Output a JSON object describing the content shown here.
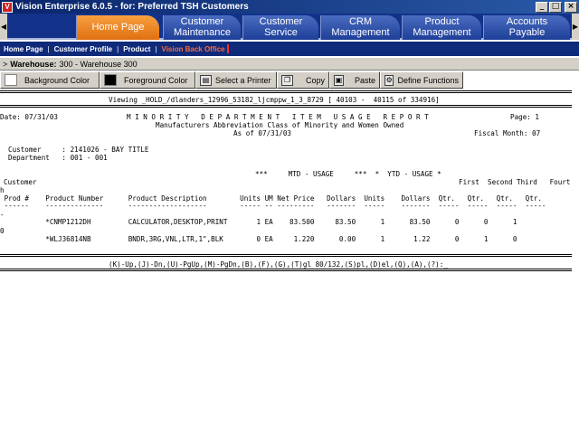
{
  "window": {
    "app_icon_glyph": "V",
    "title": "Vision Enterprise 6.0.5 - for:  Preferred TSH Customers",
    "minimize_glyph": "_",
    "maximize_glyph": "□",
    "close_glyph": "×"
  },
  "tabs": [
    {
      "line1": "Home Page",
      "line2": ""
    },
    {
      "line1": "Customer",
      "line2": "Maintenance"
    },
    {
      "line1": "Customer",
      "line2": "Service"
    },
    {
      "line1": "CRM",
      "line2": "Management"
    },
    {
      "line1": "Product",
      "line2": "Management"
    },
    {
      "line1": "Accounts",
      "line2": "Payable"
    }
  ],
  "subnav": {
    "items": [
      "Home Page",
      "Customer Profile",
      "Product",
      "Vision Back Office"
    ],
    "separator": "|"
  },
  "warehouse": {
    "prefix": ">",
    "label": "Warehouse:",
    "value": "300 - Warehouse 300"
  },
  "toolbar": {
    "background_color": "Background Color",
    "foreground_color": "Foreground Color",
    "select_printer": "Select a Printer",
    "copy": "Copy",
    "paste": "Paste",
    "define_functions": "Define Functions"
  },
  "report": {
    "viewing": "Viewing _HOLD_/dlanders_12996_53182_ljcmppw_1_3_8729 [ 40103 -  40115 of 334916]",
    "date": "Date: 07/31/03",
    "title": "M I N O R I T Y   D E P A R T M E N T   I T E M   U S A G E   R E P O R T",
    "page": "Page: 1",
    "subtitle": "Manufacturers Abbreviation Class of Minority and Women Owned",
    "as_of": "As of 07/31/03",
    "fiscal_month": "Fiscal Month: 07",
    "customer_line": "Customer     : 2141026 - BAY TITLE",
    "department_line": "Department   : 001 - 001",
    "header_group": "***     MTD - USAGE     ***  *  YTD - USAGE *",
    "header_quarters": "First  Second Third   Fourt",
    "header_customer": "Customer",
    "header_h": "h",
    "header_cols": " Prod #    Product Number      Product Description        Units UM Net Price   Dollars  Units    Dollars  Qtr.   Qtr.   Qtr.   Qtr.",
    "header_dashes": " ------    --------------      -------------------        ----- -- ---------   -------  -----    -------  -----  -----  -----  -----",
    "row_dash_marker": "-",
    "row_zero_marker": "0",
    "rows": [
      "           *CNMP1212DH         CALCULATOR,DESKTOP,PRINT       1 EA    83.500     83.50      1      83.50      0      0      1",
      "           *WLJ36814NB         BNDR,3RG,VNL,LTR,1\",BLK        0 EA     1.220      0.00      1       1.22      0      1      0"
    ],
    "command_line": "(K)-Up,(J)-Dn,(U)-PgUp,(M)-PgDn,(B),(F),(G),(T)gl 80/132,(S)pl,(D)el,(Q),(A),(?):_"
  }
}
